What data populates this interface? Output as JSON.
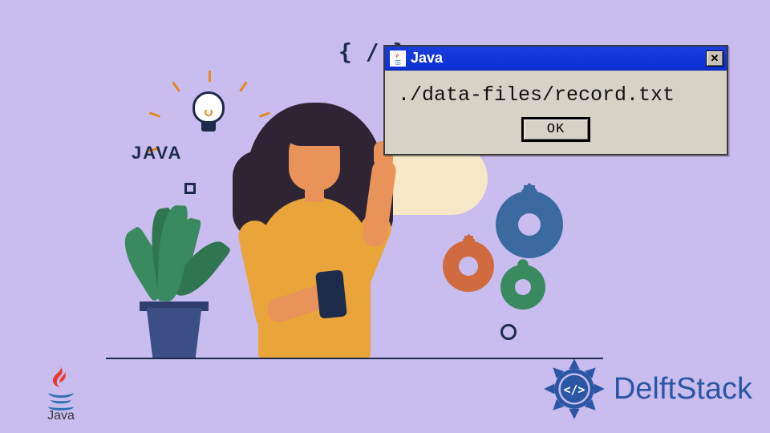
{
  "illustration": {
    "java_label": "JAVA",
    "braces": "{ / }"
  },
  "dialog": {
    "title": "Java",
    "message": "./data-files/record.txt",
    "ok_label": "OK",
    "close_glyph": "✕"
  },
  "java_logo": {
    "caption": "Java"
  },
  "brand": {
    "name": "DelftStack"
  },
  "colors": {
    "bg": "#c9bcef",
    "accent_blue": "#2b56a3",
    "titlebar": "#1a3fe0"
  }
}
